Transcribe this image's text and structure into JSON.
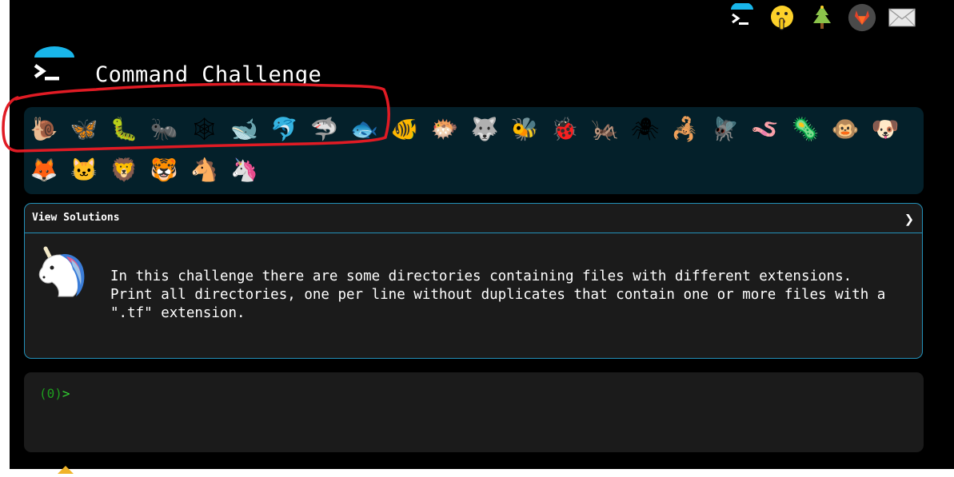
{
  "header": {
    "title": "Command Challenge",
    "top_icons": [
      "terminal-logo-icon",
      "shushing-face-icon",
      "christmas-tree-icon",
      "gitlab-icon",
      "envelope-icon"
    ]
  },
  "animals": [
    {
      "name": "snail",
      "glyph": "🐌"
    },
    {
      "name": "butterfly",
      "glyph": "🦋"
    },
    {
      "name": "caterpillar",
      "glyph": "🐛"
    },
    {
      "name": "ant",
      "glyph": "🐜"
    },
    {
      "name": "spider-web",
      "glyph": "🕸"
    },
    {
      "name": "whale",
      "glyph": "🐋"
    },
    {
      "name": "dolphin",
      "glyph": "🐬"
    },
    {
      "name": "shark",
      "glyph": "🦈"
    },
    {
      "name": "fish",
      "glyph": "🐟"
    },
    {
      "name": "tropical-fish",
      "glyph": "🐠"
    },
    {
      "name": "blowfish",
      "glyph": "🐡"
    },
    {
      "name": "wolf",
      "glyph": "🐺"
    },
    {
      "name": "bee",
      "glyph": "🐝"
    },
    {
      "name": "ladybug",
      "glyph": "🐞"
    },
    {
      "name": "cricket",
      "glyph": "🦗"
    },
    {
      "name": "spider",
      "glyph": "🕷"
    },
    {
      "name": "scorpion",
      "glyph": "🦂"
    },
    {
      "name": "fly",
      "glyph": "🪰"
    },
    {
      "name": "worm",
      "glyph": "🪱"
    },
    {
      "name": "microbe",
      "glyph": "🦠"
    },
    {
      "name": "monkey",
      "glyph": "🐵"
    },
    {
      "name": "dog",
      "glyph": "🐶"
    },
    {
      "name": "fox",
      "glyph": "🦊"
    },
    {
      "name": "cat",
      "glyph": "🐱"
    },
    {
      "name": "lion",
      "glyph": "🦁"
    },
    {
      "name": "tiger",
      "glyph": "🐯"
    },
    {
      "name": "horse",
      "glyph": "🐴"
    },
    {
      "name": "unicorn",
      "glyph": "🦄"
    }
  ],
  "solutions": {
    "header": "View Solutions",
    "chevron": "❯",
    "description": "In this challenge there are some directories containing files with different extensions.\nPrint all directories, one per line without duplicates that contain one or more files with a\n\".tf\" extension."
  },
  "terminal": {
    "prompt_paren": "(0)",
    "prompt_arrow": ">"
  },
  "colors": {
    "background": "#000000",
    "panel_dark_teal": "#04202a",
    "panel_gray": "#1b1b1b",
    "border_blue": "#2391b9",
    "prompt_green": "#33d633",
    "annotation_red": "#e01b24"
  }
}
